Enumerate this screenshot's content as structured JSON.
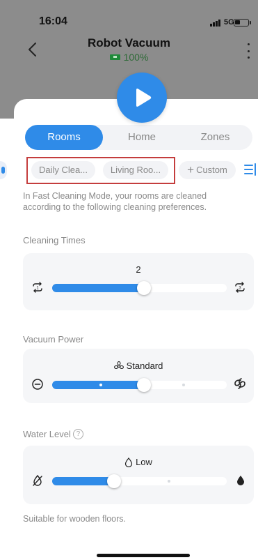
{
  "status_bar": {
    "time": "16:04",
    "network": "5G"
  },
  "header": {
    "title": "Robot Vacuum",
    "battery_percent": "100%"
  },
  "tabs": [
    {
      "label": "Rooms",
      "active": true
    },
    {
      "label": "Home",
      "active": false
    },
    {
      "label": "Zones",
      "active": false
    }
  ],
  "room_chips": [
    {
      "label": "Daily Clea..."
    },
    {
      "label": "Living Roo..."
    },
    {
      "label": "Custom"
    }
  ],
  "description": "In Fast Cleaning Mode, your rooms are cleaned according to the following cleaning preferences.",
  "cleaning_times": {
    "label": "Cleaning Times",
    "value": "2",
    "min": 1,
    "max": 3,
    "level_fraction": 0.5
  },
  "vacuum_power": {
    "label": "Vacuum Power",
    "value": "Standard",
    "level_fraction": 0.5
  },
  "water_level": {
    "label": "Water Level",
    "help_symbol": "?",
    "value": "Low",
    "level_fraction": 0.33
  },
  "footnote": "Suitable for wooden floors.",
  "colors": {
    "accent": "#2f8be8",
    "highlight_border": "#c43d3d",
    "battery_green": "#1f8a3a"
  }
}
